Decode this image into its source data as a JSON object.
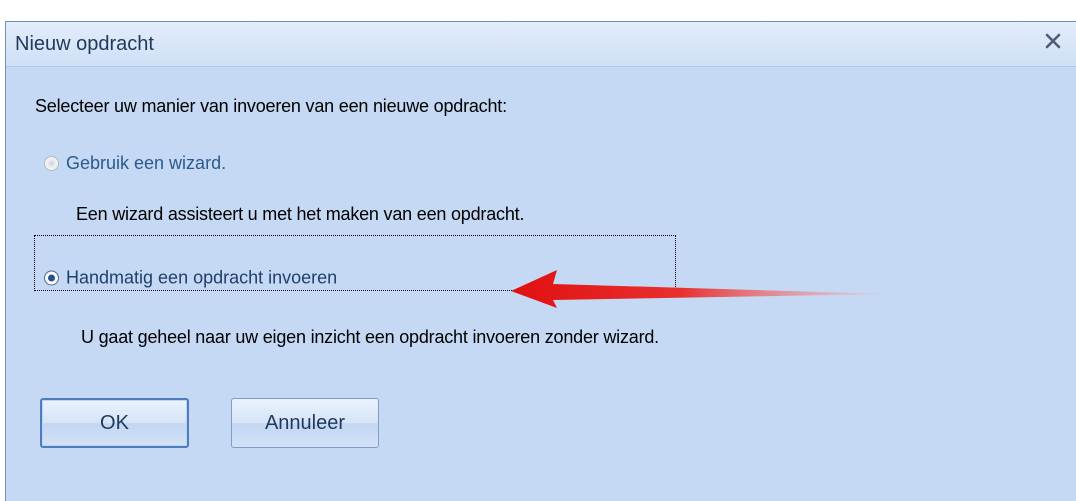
{
  "dialog": {
    "title": "Nieuw opdracht",
    "close_label": "x",
    "prompt": "Selecteer uw manier van invoeren van een nieuwe opdracht:",
    "options": [
      {
        "label": "Gebruik een wizard.",
        "description": "Een wizard assisteert u met het maken van een opdracht.",
        "selected": false,
        "enabled": false
      },
      {
        "label": "Handmatig een opdracht invoeren",
        "description": "U gaat geheel naar uw eigen inzicht een opdracht invoeren zonder wizard.",
        "selected": true,
        "enabled": true
      }
    ],
    "buttons": {
      "ok_label": "OK",
      "cancel_label": "Annuleer"
    }
  },
  "annotation": {
    "icon": "red-arrow-icon",
    "color": "#e01010"
  },
  "colors": {
    "dialog_bg": "#c5d9f4",
    "title_text": "#1e395b"
  }
}
